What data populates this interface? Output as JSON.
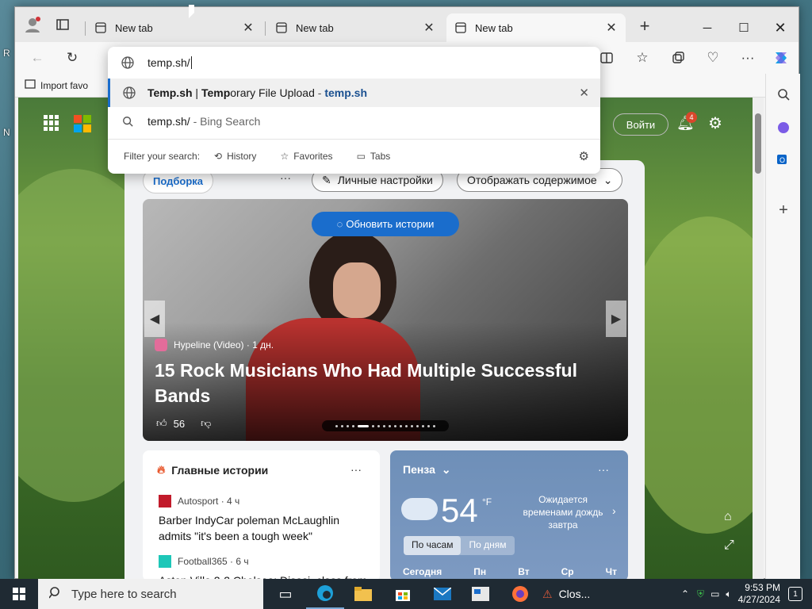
{
  "browser": {
    "tabs": [
      {
        "label": "New tab"
      },
      {
        "label": "New tab"
      },
      {
        "label": "New tab"
      }
    ],
    "favorites_bar": {
      "import_label": "Import favo"
    }
  },
  "omnibox": {
    "typed_value": "temp.sh/",
    "suggestions": [
      {
        "bold": "Temp.sh",
        "sep": " | ",
        "bold2": "Temp",
        "rest": "orary File Upload",
        "dash": " - ",
        "url": "temp.sh"
      },
      {
        "text": "temp.sh/",
        "suffix": " - Bing Search"
      }
    ],
    "filter": {
      "label": "Filter your search:",
      "history": "History",
      "favorites": "Favorites",
      "tabs": "Tabs"
    }
  },
  "msn": {
    "signin": "Войти",
    "notification_count": "4",
    "feed_tab": "Подборка",
    "more": "···",
    "personalize": "Личные настройки",
    "display_content": "Отображать содержимое",
    "refresh_stories": "Обновить истории",
    "hero": {
      "source": "Hypeline (Video) · 1 дн.",
      "title": "15 Rock Musicians Who Had Multiple Successful Bands",
      "likes": "56"
    },
    "top_stories": {
      "heading": "Главные истории",
      "items": [
        {
          "source": "Autosport · 4 ч",
          "title": "Barber IndyCar pole­man McLaughlin admits \"it's been a tough week\""
        },
        {
          "source": "Football365 · 6 ч",
          "title": "Aston Villa 2-2 Chelsea: Disasi, class from"
        }
      ]
    },
    "weather": {
      "city": "Пенза",
      "temp": "54",
      "unit": "°F",
      "forecast": "Ожидается временами дождь завтра",
      "hourly": "По часам",
      "daily": "По дням",
      "days": [
        "Сегодня",
        "Пн",
        "Вт",
        "Ср",
        "Чт"
      ]
    }
  },
  "taskbar": {
    "search_placeholder": "Type here to search",
    "pinned_label": "Clos...",
    "time": "9:53 PM",
    "date": "4/27/2024",
    "notif": "1"
  },
  "colors": {
    "accent": "#1a6dcc",
    "taskbar": "#1f2a33"
  }
}
